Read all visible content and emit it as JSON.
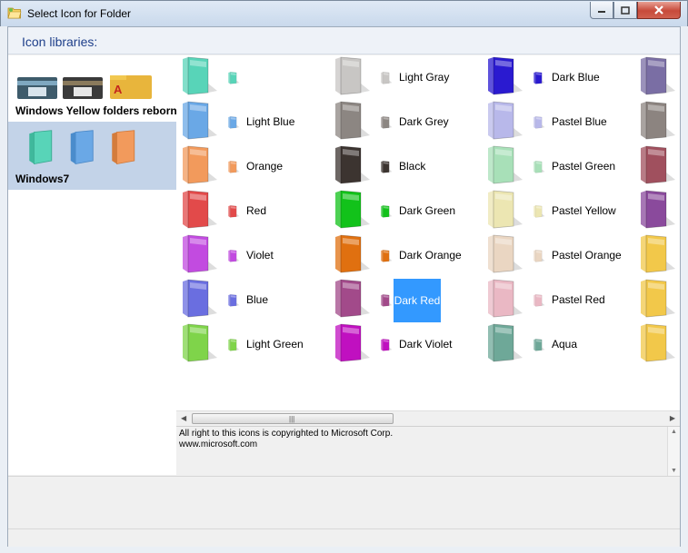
{
  "window": {
    "title": "Select Icon for Folder"
  },
  "header": {
    "label": "Icon libraries:"
  },
  "libraries": [
    {
      "name": "Windows Yellow folders reborn",
      "selected": false
    },
    {
      "name": "Windows7",
      "selected": true
    }
  ],
  "icons": [
    {
      "label": "",
      "color": "#58d4b8"
    },
    {
      "label": "Light Blue",
      "color": "#6aa8e6"
    },
    {
      "label": "Orange",
      "color": "#f29a5c"
    },
    {
      "label": "Red",
      "color": "#e24a4a"
    },
    {
      "label": "Violet",
      "color": "#c24be0"
    },
    {
      "label": "Blue",
      "color": "#6a6ee0"
    },
    {
      "label": "Light Green",
      "color": "#7fd44a"
    },
    {
      "label": "Light Gray",
      "color": "#c8c6c4"
    },
    {
      "label": "Dark Grey",
      "color": "#8c8682"
    },
    {
      "label": "Black",
      "color": "#3c3430"
    },
    {
      "label": "Dark Green",
      "color": "#12c21a"
    },
    {
      "label": "Dark Orange",
      "color": "#e07010"
    },
    {
      "label": "Dark Red",
      "color": "#a24a8a",
      "selected": true
    },
    {
      "label": "Dark Violet",
      "color": "#c010c0"
    },
    {
      "label": "Dark Blue",
      "color": "#2a1ad0"
    },
    {
      "label": "Pastel Blue",
      "color": "#b8b8ea"
    },
    {
      "label": "Pastel Green",
      "color": "#a8e0b8"
    },
    {
      "label": "Pastel Yellow",
      "color": "#ece6b2"
    },
    {
      "label": "Pastel Orange",
      "color": "#ead6c2"
    },
    {
      "label": "Pastel Red",
      "color": "#eab8c4"
    },
    {
      "label": "Aqua",
      "color": "#6ea898"
    }
  ],
  "partial_icons": [
    {
      "color": "#7a6ea4"
    },
    {
      "color": "#8c8480"
    },
    {
      "color": "#a0505e"
    },
    {
      "color": "#8a4a9c"
    },
    {
      "color": "#f2c84a"
    },
    {
      "color": "#f2c84a"
    },
    {
      "color": "#f2c84a"
    }
  ],
  "copyright": {
    "line1": "All right to this icons is copyrighted to Microsoft Corp.",
    "line2": "www.microsoft.com"
  },
  "colors": {
    "selection": "#3399ff",
    "library_selected": "#c3d3e8",
    "header_text": "#1e3f8a"
  }
}
